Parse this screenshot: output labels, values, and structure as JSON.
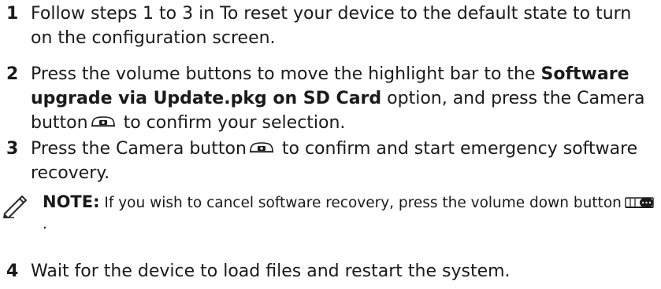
{
  "steps": [
    {
      "number": "1",
      "text": "Follow steps 1 to 3 in To reset your device to the default state to turn on the configuration screen."
    },
    {
      "number": "2",
      "pre": "Press the volume buttons to move the highlight bar to the ",
      "bold": "Software upgrade via Update.pkg on SD Card",
      "mid": " option, and press the Camera button",
      "post": " to confirm your selection."
    },
    {
      "number": "3",
      "pre": "Press the Camera button",
      "post": " to confirm and start emergency software recovery."
    },
    {
      "number": "4",
      "text": "Wait for the device to load files and restart the system."
    }
  ],
  "note": {
    "label": "NOTE:",
    "text": " If you wish to cancel software recovery, press the volume down button",
    "end": "."
  },
  "icons": {
    "note": "pencil-note-icon",
    "camera": "camera-button-icon",
    "volume_down": "volume-down-button-icon"
  }
}
